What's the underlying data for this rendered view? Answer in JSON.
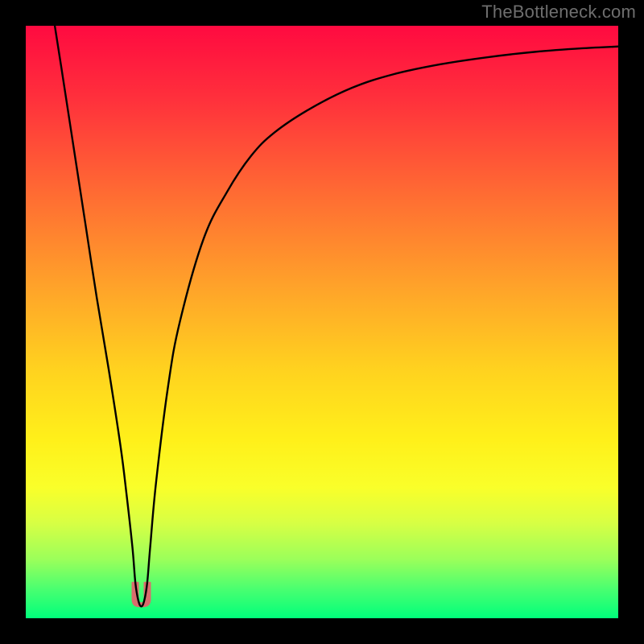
{
  "watermark": "TheBottleneck.com",
  "colors": {
    "frame": "#000000",
    "curve_stroke": "#000000",
    "notch_fill": "#d86d6d",
    "gradient_stops": [
      "#ff0a40",
      "#ff2f3c",
      "#ff6a33",
      "#ffa629",
      "#ffd21f",
      "#fff01a",
      "#f9ff2a",
      "#d7ff44",
      "#9cff5a",
      "#4bff70",
      "#00ff7b"
    ]
  },
  "chart_data": {
    "type": "line",
    "title": "",
    "xlabel": "",
    "ylabel": "",
    "xlim": [
      0,
      100
    ],
    "ylim": [
      0,
      100
    ],
    "x": [
      4.9,
      6,
      8,
      10,
      12,
      14,
      16,
      17,
      18,
      18.5,
      19,
      19.5,
      20,
      20.5,
      21,
      22,
      24,
      26,
      30,
      34,
      38,
      42,
      48,
      55,
      62,
      70,
      78,
      86,
      94,
      100
    ],
    "y": [
      100,
      93,
      80,
      67,
      54,
      42,
      29,
      21,
      12,
      6,
      3,
      2,
      3,
      6,
      12,
      23,
      39,
      50,
      64,
      72,
      78,
      82,
      86,
      89.5,
      91.8,
      93.5,
      94.7,
      95.6,
      96.2,
      96.5
    ],
    "notch_x": 19.5,
    "notch_y_span": [
      2,
      6
    ],
    "note": "x and y in percent of plot area; y measured upward from bottom; curve is a V-shaped bottleneck dip near x≈19.5% rising asymptotically to the right."
  }
}
